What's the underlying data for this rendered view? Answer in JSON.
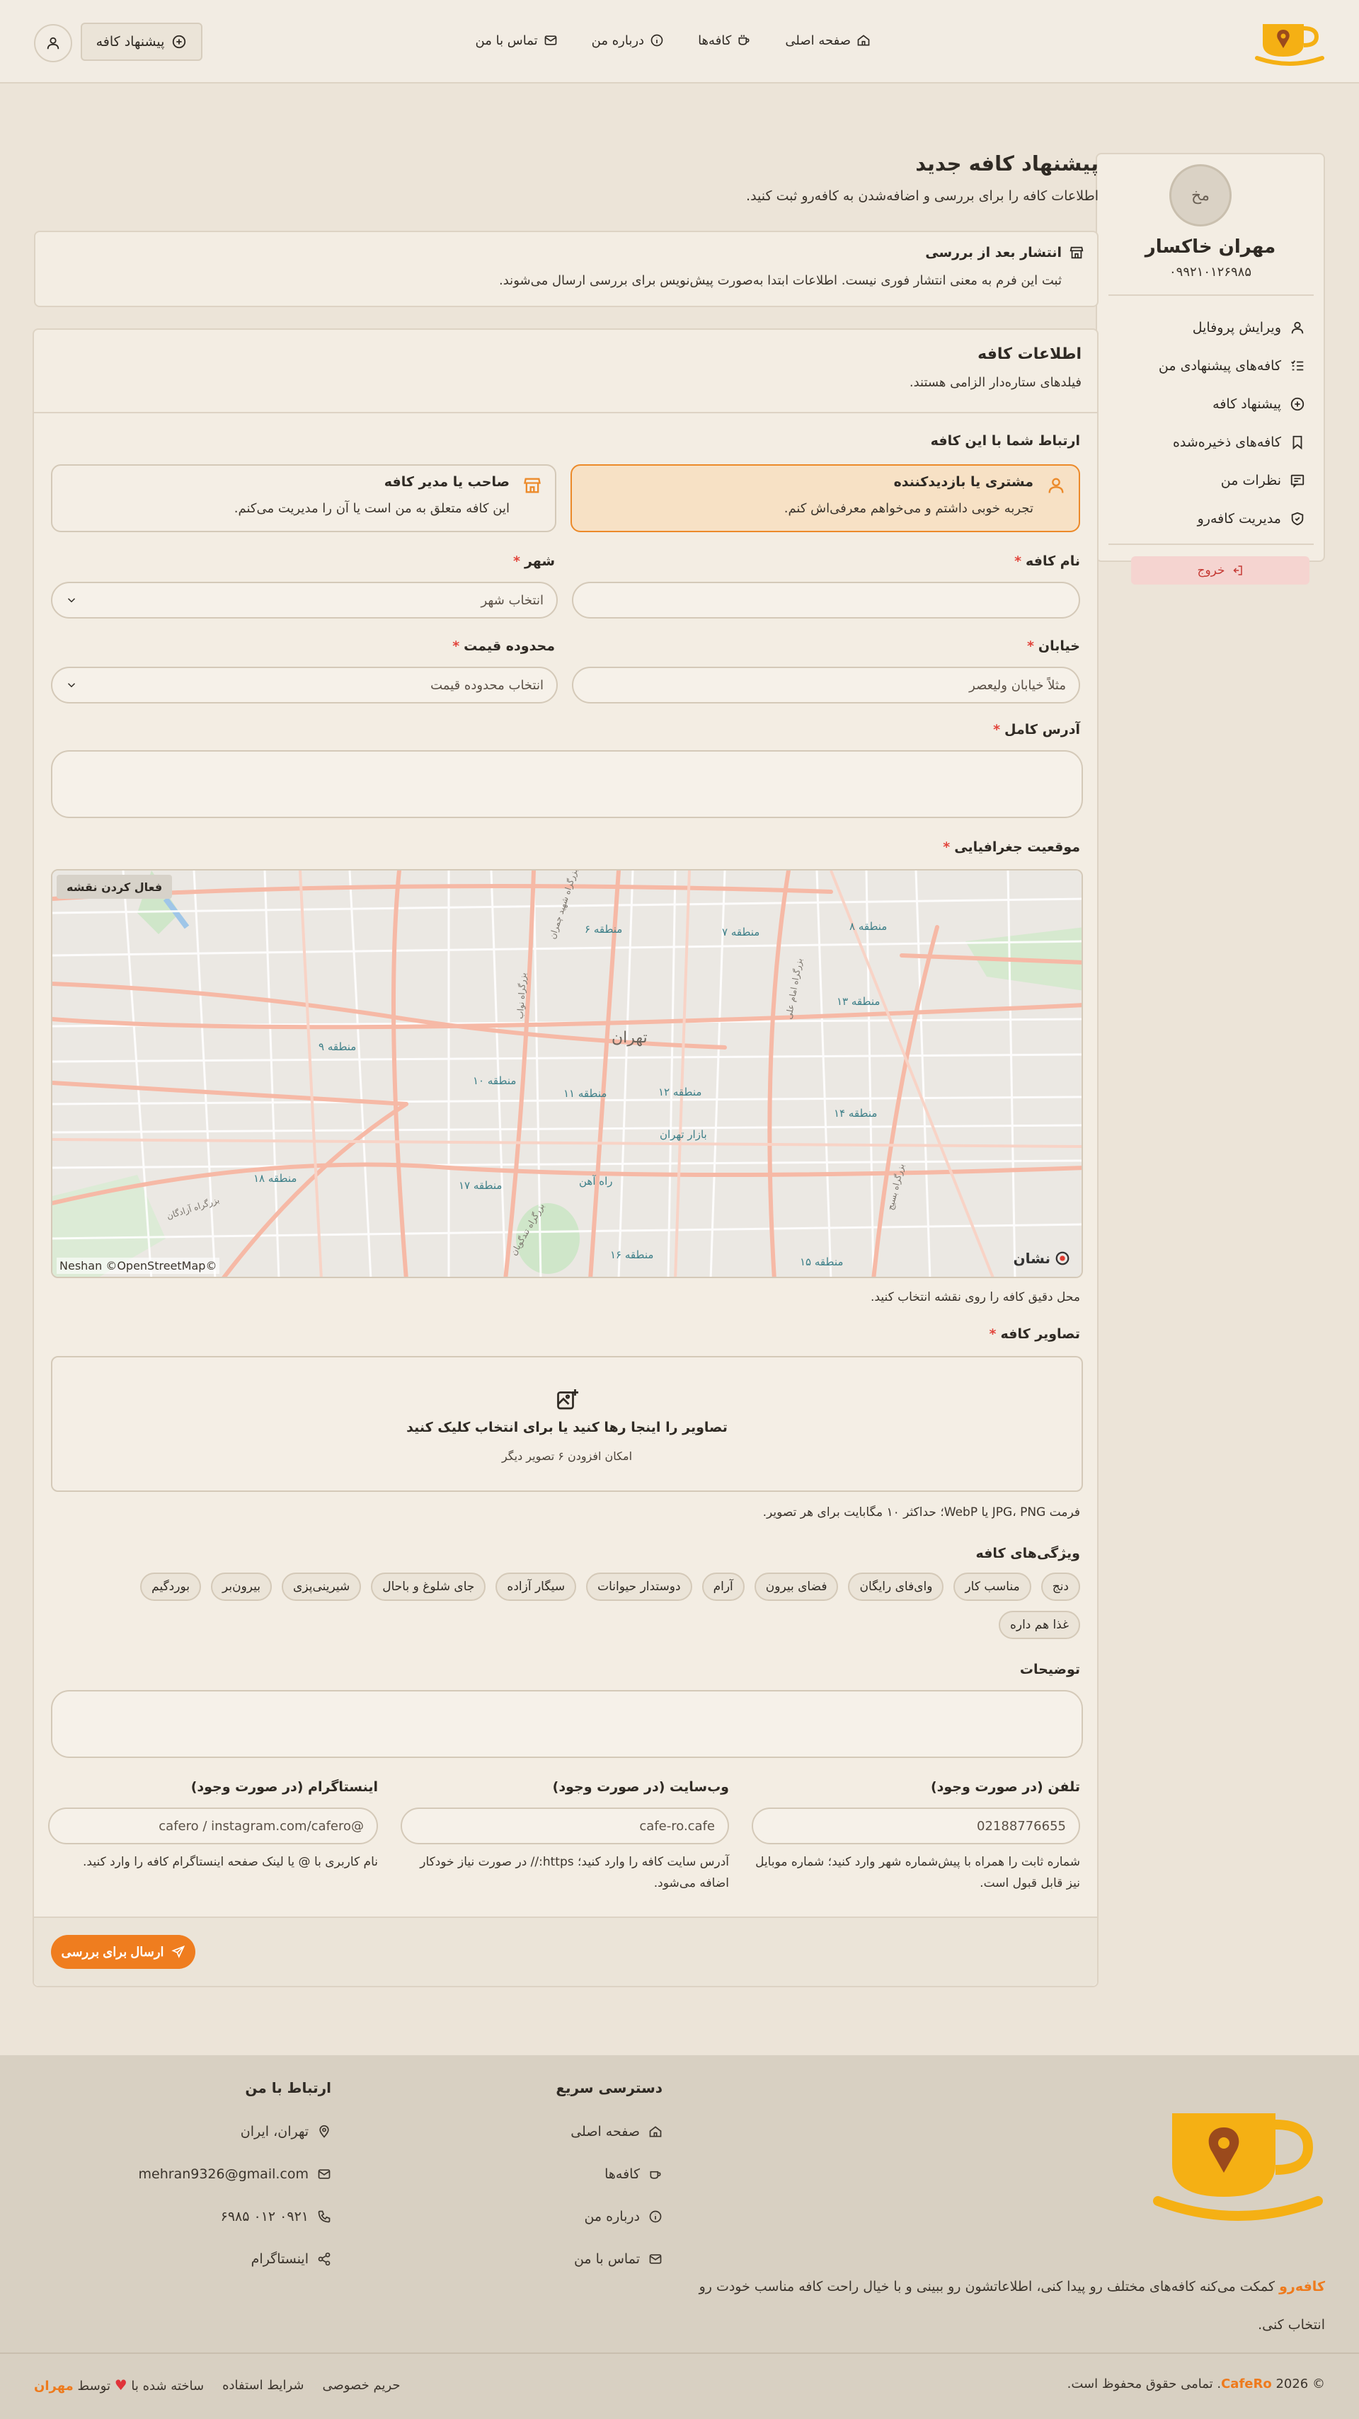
{
  "nav": {
    "home": "صفحه اصلی",
    "cafes": "کافه‌ها",
    "about": "درباره من",
    "contact": "تماس با من",
    "suggest_button": "پیشنهاد کافه"
  },
  "sidebar": {
    "avatar_initials": "مخ",
    "name": "مهران خاکسار",
    "phone": "۰۹۹۲۱۰۱۲۶۹۸۵",
    "items": [
      {
        "label": "ویرایش پروفایل",
        "icon": "user-icon"
      },
      {
        "label": "کافه‌های پیشنهادی من",
        "icon": "list-check-icon"
      },
      {
        "label": "پیشنهاد کافه",
        "icon": "plus-circle-icon"
      },
      {
        "label": "کافه‌های ذخیره‌شده",
        "icon": "bookmark-icon"
      },
      {
        "label": "نظرات من",
        "icon": "comment-icon"
      },
      {
        "label": "مدیریت کافه‌رو",
        "icon": "shield-icon"
      }
    ],
    "logout": "خروج"
  },
  "page": {
    "title": "پیشنهاد کافه جدید",
    "subtitle": "اطلاعات کافه را برای بررسی و اضافه‌شدن به کافه‌رو ثبت کنید."
  },
  "notice": {
    "title": "انتشار بعد از بررسی",
    "text": "ثبت این فرم به معنی انتشار فوری نیست. اطلاعات ابتدا به‌صورت پیش‌نویس برای بررسی ارسال می‌شوند."
  },
  "form": {
    "section_title": "اطلاعات کافه",
    "section_sub": "فیلدهای ستاره‌دار الزامی هستند.",
    "relation_label": "ارتباط شما با این کافه",
    "relation_options": [
      {
        "title": "مشتری یا بازدیدکننده",
        "desc": "تجربه خوبی داشتم و می‌خواهم معرفی‌اش کنم.",
        "selected": true
      },
      {
        "title": "صاحب یا مدیر کافه",
        "desc": "این کافه متعلق به من است یا آن را مدیریت می‌کنم.",
        "selected": false
      }
    ],
    "name_label": "نام کافه",
    "name_value": "",
    "city_label": "شهر",
    "city_placeholder": "انتخاب شهر",
    "street_label": "خیابان",
    "street_placeholder": "مثلاً خیابان ولیعصر",
    "price_label": "محدوده قیمت",
    "price_placeholder": "انتخاب محدوده قیمت",
    "address_label": "آدرس کامل",
    "location_label": "موقعیت جغرافیایی",
    "map_activate": "فعال کردن نقشه",
    "map_credit": "©Neshan ©OpenStreetMap",
    "map_brand": "نشان",
    "map_city": "تهران",
    "map_labels": [
      "منطقه ۶",
      "منطقه ۷",
      "منطقه ۸",
      "منطقه ۱۳",
      "منطقه ۹",
      "منطقه ۱۰",
      "منطقه ۱۱",
      "منطقه ۱۲",
      "بازار تهران",
      "منطقه ۱۴",
      "راه آهن",
      "منطقه ۱۷",
      "منطقه ۱۸",
      "منطقه ۱۶",
      "منطقه ۱۵"
    ],
    "map_roads": [
      "بزرگراه شهید چمران",
      "بزرگراه امام علی",
      "بزرگراه بسیج",
      "بزرگراه آزادگان",
      "بزرگراه نواب",
      "بزرگراه تندگویان"
    ],
    "map_help": "محل دقیق کافه را روی نقشه انتخاب کنید.",
    "images_label": "تصاویر کافه",
    "upload_title": "تصاویر را اینجا رها کنید یا برای انتخاب کلیک کنید",
    "upload_sub": "امکان افزودن ۶ تصویر دیگر",
    "upload_help": "فرمت JPG، PNG یا WebP؛ حداکثر ۱۰ مگابایت برای هر تصویر.",
    "features_label": "ویژگی‌های کافه",
    "features": [
      "دنج",
      "مناسب کار",
      "وای‌فای رایگان",
      "فضای بیرون",
      "آرام",
      "دوستدار حیوانات",
      "سیگار آزاده",
      "جای شلوغ و باحال",
      "شیرینی‌پزی",
      "بیرون‌بر",
      "بوردگیم",
      "غذا هم داره"
    ],
    "description_label": "توضیحات",
    "phone_label": "تلفن (در صورت وجود)",
    "phone_placeholder": "02188776655",
    "phone_help": "شماره ثابت را همراه با پیش‌شماره شهر وارد کنید؛ شماره موبایل نیز قابل قبول است.",
    "website_label": "وب‌سایت (در صورت وجود)",
    "website_placeholder": "cafe-ro.cafe",
    "website_help": "آدرس سایت کافه را وارد کنید؛ https:// در صورت نیاز خودکار اضافه می‌شود.",
    "instagram_label": "اینستاگرام (در صورت وجود)",
    "instagram_placeholder": "@cafero / instagram.com/cafero",
    "instagram_help": "نام کاربری با @ یا لینک صفحه اینستاگرام کافه را وارد کنید.",
    "submit": "ارسال برای بررسی"
  },
  "footer": {
    "brand": "کافه‌رو",
    "description": " کمکت می‌کنه کافه‌های مختلف رو پیدا کنی، اطلاعاتشون رو ببینی و با خیال راحت کافه مناسب خودت رو انتخاب کنی.",
    "quick_title": "دسترسی سریع",
    "quick_links": [
      "صفحه اصلی",
      "کافه‌ها",
      "درباره من",
      "تماس با من"
    ],
    "contact_title": "ارتباط با من",
    "contact_items": [
      "تهران، ایران",
      "mehran9326@gmail.com",
      "۰۹۲۱ ۰۱۲ ۶۹۸۵",
      "اینستاگرام"
    ],
    "copyright_pre": "© 2026 ",
    "copyright_brand": "CafeRo",
    "copyright_post": ". تمامی حقوق محفوظ است.",
    "privacy": "حریم خصوصی",
    "terms": "شرایط استفاده",
    "made_pre": "ساخته شده با",
    "made_by": "توسط",
    "made_name": "مهران"
  },
  "colors": {
    "accent": "#ef7d1f",
    "background": "#ece4d8",
    "danger": "#e2453c",
    "logo": "#f5b014"
  }
}
